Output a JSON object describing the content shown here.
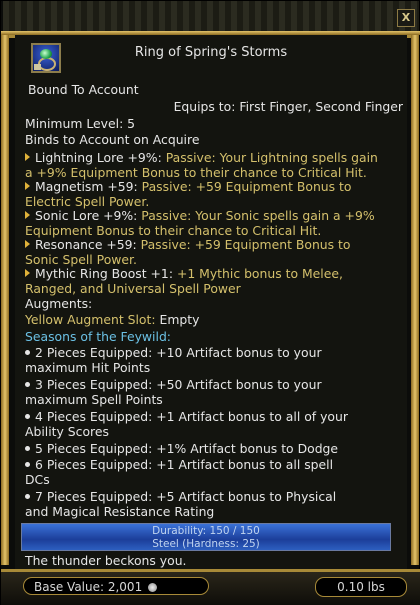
{
  "window": {
    "title": "Ring of Spring's Storms",
    "close_label": "X"
  },
  "item": {
    "bound": "Bound To Account",
    "equips_to": "Equips to: First Finger, Second Finger",
    "min_level": "Minimum Level: 5",
    "binds": "Binds to Account on Acquire"
  },
  "effects": [
    {
      "name": "Lightning Lore +9%:",
      "desc1": " Passive: Your Lightning spells gain",
      "desc2": "a +9% Equipment Bonus to their chance to Critical Hit."
    },
    {
      "name": "Magnetism +59:",
      "desc1": " Passive: +59 Equipment Bonus to",
      "desc2": "Electric Spell Power."
    },
    {
      "name": "Sonic Lore +9%:",
      "desc1": " Passive: Your Sonic spells gain a +9%",
      "desc2": "Equipment Bonus to their chance to Critical Hit."
    },
    {
      "name": "Resonance +59:",
      "desc1": " Passive: +59 Equipment Bonus to",
      "desc2": "Sonic Spell Power."
    },
    {
      "name": "Mythic Ring Boost +1:",
      "desc1": " +1 Mythic bonus to Melee,",
      "desc2": "Ranged, and Universal Spell Power"
    }
  ],
  "augments": {
    "label": "Augments:",
    "slot_label": "Yellow Augment Slot:",
    "slot_value": " Empty"
  },
  "set": {
    "name": "Seasons of the Feywild:",
    "bonuses": [
      {
        "line1": "2 Pieces Equipped: +10 Artifact bonus to your",
        "line2": "maximum Hit Points"
      },
      {
        "line1": "3 Pieces Equipped: +50 Artifact bonus to your",
        "line2": "maximum Spell Points"
      },
      {
        "line1": "4 Pieces Equipped: +1 Artifact bonus to all of your",
        "line2": "Ability Scores"
      },
      {
        "line1": "5 Pieces Equipped: +1% Artifact bonus to Dodge",
        "line2": ""
      },
      {
        "line1": "6 Pieces Equipped: +1 Artifact bonus to all spell",
        "line2": "DCs"
      },
      {
        "line1": "7 Pieces Equipped: +5 Artifact bonus to Physical",
        "line2": "and Magical Resistance Rating"
      }
    ]
  },
  "durability": {
    "line1": "Durability: 150 / 150",
    "line2": "Steel (Hardness: 25)"
  },
  "flavor": "The thunder beckons you.",
  "footer": {
    "base_value": "Base Value: 2,001",
    "weight": "0.10 lbs"
  },
  "colors": {
    "gold_text": "#d4c06c",
    "set_name": "#6bc0e4",
    "frame_gold": "#a88a38"
  },
  "icons": [
    "ring-item-icon",
    "close-icon",
    "platinum-coin-icon"
  ]
}
